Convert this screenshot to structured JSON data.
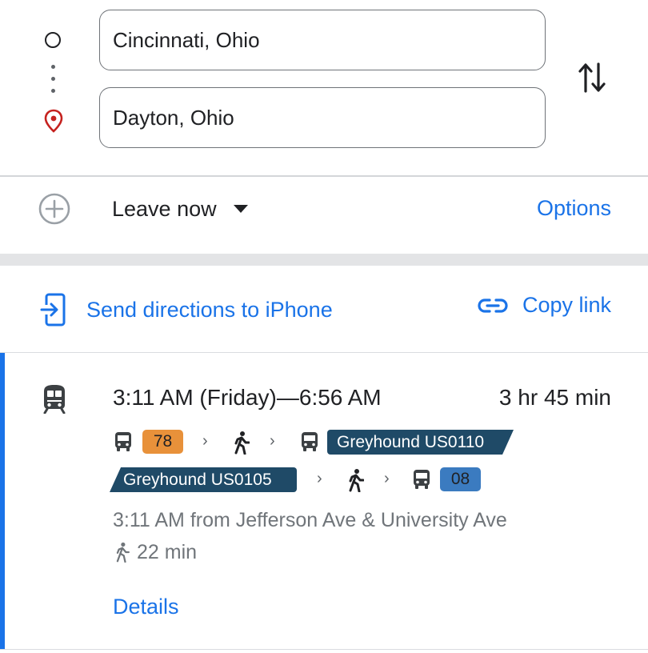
{
  "search": {
    "origin_value": "Cincinnati, Ohio",
    "destination_value": "Dayton, Ohio"
  },
  "icons": {
    "origin": "origin-circle-icon",
    "destination": "destination-pin-icon",
    "swap": "swap-arrows-icon",
    "add_stop": "add-stop-icon",
    "dropdown": "caret-down-icon",
    "send": "send-to-phone-icon",
    "link": "link-icon",
    "transit": "train-icon",
    "bus": "bus-icon",
    "walk": "walk-icon"
  },
  "controls": {
    "leave_label": "Leave now",
    "options_label": "Options"
  },
  "share": {
    "send_label": "Send directions to iPhone",
    "copy_label": "Copy link"
  },
  "route": {
    "time_range": "3:11 AM (Friday)—6:56 AM",
    "duration": "3 hr 45 min",
    "step1_bus": "78",
    "step2_greyhound": "Greyhound US0110",
    "step3_greyhound": "Greyhound US0105",
    "step4_bus": "08",
    "departure": "3:11 AM from Jefferson Ave & University Ave",
    "walk_time": "22 min",
    "details_label": "Details"
  },
  "colors": {
    "accent": "#1a73e8",
    "pin": "#c5221f",
    "bus78": "#e8913a",
    "bus08": "#3b7bc0",
    "greyhound": "#1f4a67"
  }
}
